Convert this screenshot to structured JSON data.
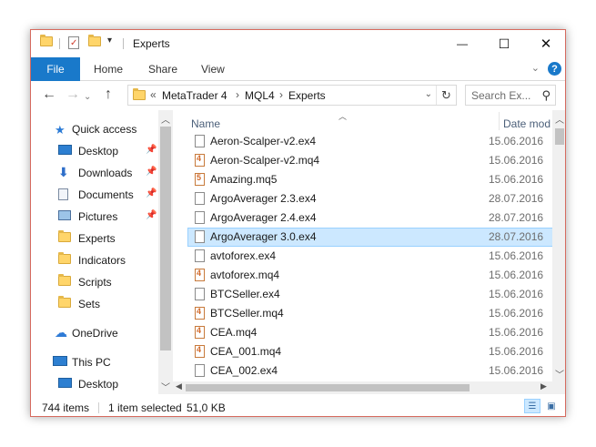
{
  "window": {
    "title": "Experts",
    "controls": {
      "minimize": "—",
      "maximize": "☐",
      "close": "✕"
    }
  },
  "ribbon": {
    "tabs": [
      "File",
      "Home",
      "Share",
      "View"
    ],
    "help": "?"
  },
  "address": {
    "overflow": "«",
    "crumbs": [
      "MetaTrader 4",
      "MQL4",
      "Experts"
    ],
    "separator": "›"
  },
  "search": {
    "placeholder": "Search Ex..."
  },
  "nav": {
    "items": [
      {
        "label": "Quick access",
        "icon": "star-icon",
        "pinned": false
      },
      {
        "label": "Desktop",
        "icon": "desktop-icon",
        "pinned": true
      },
      {
        "label": "Downloads",
        "icon": "download-icon",
        "pinned": true
      },
      {
        "label": "Documents",
        "icon": "documents-icon",
        "pinned": true
      },
      {
        "label": "Pictures",
        "icon": "pictures-icon",
        "pinned": true
      },
      {
        "label": "Experts",
        "icon": "folder-icon",
        "pinned": false
      },
      {
        "label": "Indicators",
        "icon": "folder-icon",
        "pinned": false
      },
      {
        "label": "Scripts",
        "icon": "folder-icon",
        "pinned": false
      },
      {
        "label": "Sets",
        "icon": "folder-icon",
        "pinned": false
      },
      {
        "label": "OneDrive",
        "icon": "onedrive-icon",
        "pinned": false
      },
      {
        "label": "This PC",
        "icon": "this-pc-icon",
        "pinned": false
      },
      {
        "label": "Desktop",
        "icon": "desktop-icon",
        "pinned": false
      }
    ]
  },
  "files": {
    "columns": {
      "name": "Name",
      "date": "Date mod"
    },
    "rows": [
      {
        "name": "Aeron-Scalper-v2.ex4",
        "date": "15.06.2016",
        "type": "ex4",
        "selected": false
      },
      {
        "name": "Aeron-Scalper-v2.mq4",
        "date": "15.06.2016",
        "type": "mq4",
        "selected": false
      },
      {
        "name": "Amazing.mq5",
        "date": "15.06.2016",
        "type": "mq5",
        "selected": false
      },
      {
        "name": "ArgoAverager 2.3.ex4",
        "date": "28.07.2016",
        "type": "ex4",
        "selected": false
      },
      {
        "name": "ArgoAverager 2.4.ex4",
        "date": "28.07.2016",
        "type": "ex4",
        "selected": false
      },
      {
        "name": "ArgoAverager 3.0.ex4",
        "date": "28.07.2016",
        "type": "ex4",
        "selected": true
      },
      {
        "name": "avtoforex.ex4",
        "date": "15.06.2016",
        "type": "ex4",
        "selected": false
      },
      {
        "name": "avtoforex.mq4",
        "date": "15.06.2016",
        "type": "mq4",
        "selected": false
      },
      {
        "name": "BTCSeller.ex4",
        "date": "15.06.2016",
        "type": "ex4",
        "selected": false
      },
      {
        "name": "BTCSeller.mq4",
        "date": "15.06.2016",
        "type": "mq4",
        "selected": false
      },
      {
        "name": "CEA.mq4",
        "date": "15.06.2016",
        "type": "mq4",
        "selected": false
      },
      {
        "name": "CEA_001.mq4",
        "date": "15.06.2016",
        "type": "mq4",
        "selected": false
      },
      {
        "name": "CEA_002.ex4",
        "date": "15.06.2016",
        "type": "ex4",
        "selected": false
      }
    ]
  },
  "status": {
    "count": "744 items",
    "selection": "1 item selected",
    "size": "51,0 KB"
  },
  "colors": {
    "accent": "#1979ca",
    "selection_bg": "#cce8ff",
    "selection_border": "#99d1ff",
    "window_border": "#d66a5e"
  }
}
